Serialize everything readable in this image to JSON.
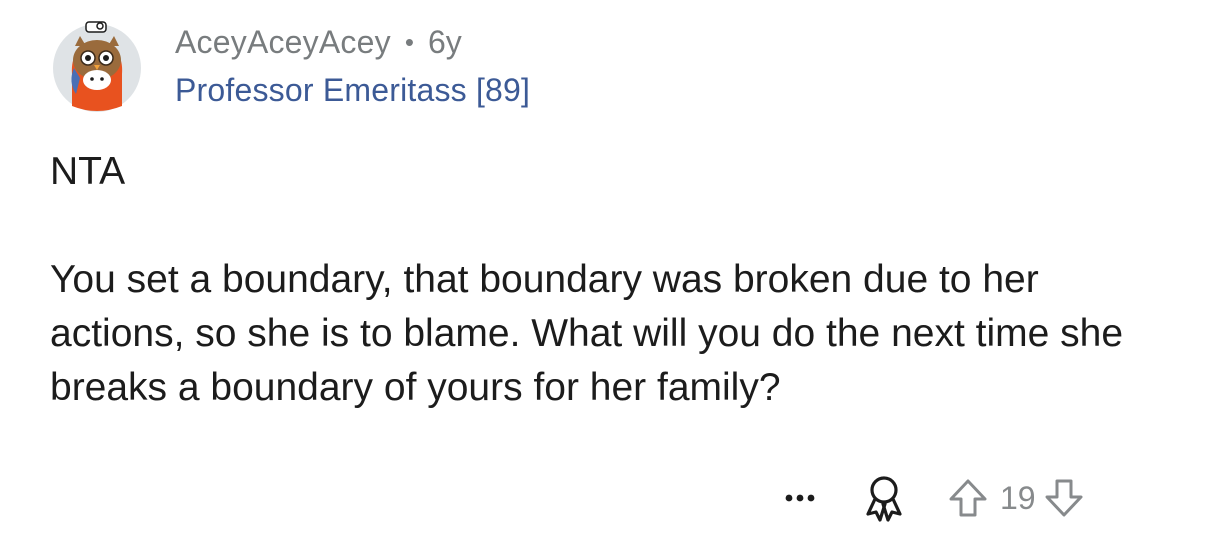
{
  "comment": {
    "username": "AceyAceyAcey",
    "separator": "•",
    "age": "6y",
    "flair": "Professor Emeritass [89]",
    "paragraphs": [
      "NTA",
      "You set a boundary, that boundary was broken due to her actions, so she is to blame. What will you do the next time she breaks a boundary of yours for her family?"
    ]
  },
  "actions": {
    "more_icon": "ellipsis-icon",
    "award_icon": "award-icon",
    "upvote_icon": "arrow-up-icon",
    "downvote_icon": "arrow-down-icon",
    "score": "19"
  },
  "colors": {
    "username": "#787c7e",
    "flair": "#3c5a96",
    "text": "#1c1c1c",
    "icon": "#878a8c",
    "avatar_bg": "#dfe3e6"
  }
}
